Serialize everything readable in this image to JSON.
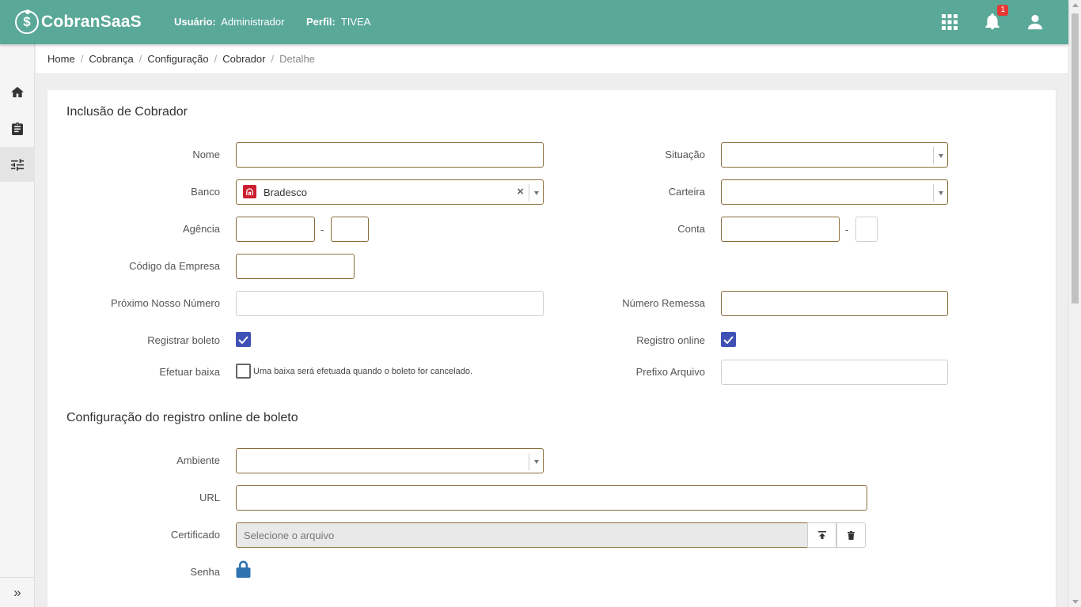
{
  "header": {
    "brand": "CobranSaaS",
    "user_label": "Usuário:",
    "user_value": "Administrador",
    "profile_label": "Perfil:",
    "profile_value": "TIVEA",
    "notification_count": "1",
    "accent_color": "#5aa898"
  },
  "breadcrumb": [
    "Home",
    "Cobrança",
    "Configuração",
    "Cobrador",
    "Detalhe"
  ],
  "sidebar": {
    "items": [
      "home-icon",
      "clipboard-icon",
      "sliders-icon"
    ],
    "expand_label": "»"
  },
  "form": {
    "title": "Inclusão de Cobrador",
    "nome_label": "Nome",
    "nome_value": "",
    "situacao_label": "Situação",
    "situacao_value": "",
    "banco_label": "Banco",
    "banco_value": "Bradesco",
    "carteira_label": "Carteira",
    "carteira_value": "",
    "agencia_label": "Agência",
    "agencia_value": "",
    "agencia_digito": "",
    "conta_label": "Conta",
    "conta_value": "",
    "conta_digito": "",
    "codigo_empresa_label": "Código da Empresa",
    "codigo_empresa_value": "",
    "proximo_nosso_numero_label": "Próximo Nosso Número",
    "proximo_nosso_numero_value": "",
    "numero_remessa_label": "Número Remessa",
    "numero_remessa_value": "",
    "registrar_boleto_label": "Registrar boleto",
    "registrar_boleto_checked": true,
    "registro_online_label": "Registro online",
    "registro_online_checked": true,
    "efetuar_baixa_label": "Efetuar baixa",
    "efetuar_baixa_checked": false,
    "efetuar_baixa_note": "Uma baixa será efetuada quando o boleto for cancelado.",
    "prefixo_arquivo_label": "Prefixo Arquivo",
    "prefixo_arquivo_value": "",
    "dash": "-"
  },
  "online": {
    "title": "Configuração do registro online de boleto",
    "ambiente_label": "Ambiente",
    "ambiente_value": "",
    "url_label": "URL",
    "url_value": "",
    "certificado_label": "Certificado",
    "certificado_placeholder": "Selecione o arquivo",
    "senha_label": "Senha"
  }
}
